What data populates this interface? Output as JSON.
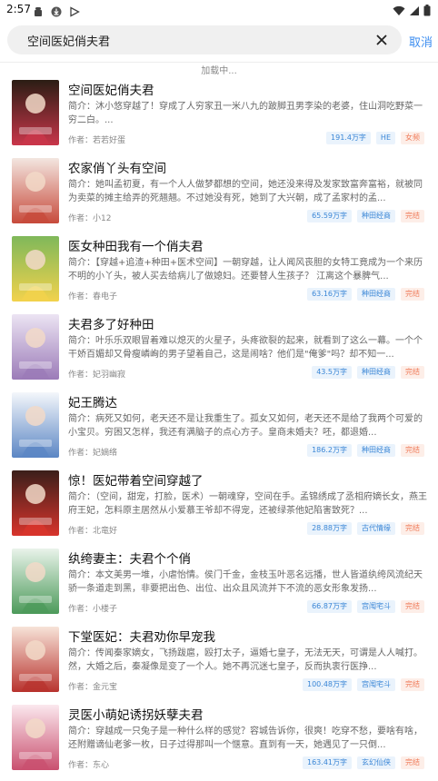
{
  "status_bar": {
    "time": "2:57",
    "left_icons": [
      "android-icon",
      "download-icon",
      "play-icon"
    ],
    "right_icons": [
      "wifi-icon",
      "signal-icon",
      "battery-icon"
    ]
  },
  "search": {
    "query": "空间医妃俏夫君",
    "cancel_label": "取消"
  },
  "loading_text": "加载中...",
  "colors": {
    "accent": "#3d8ef0",
    "tag_blue": "#3a86d6",
    "tag_orange": "#f07c5a"
  },
  "books": [
    {
      "title": "空间医妃俏夫君",
      "desc": "简介：沐小悠穿越了！穿成了人穷家丑一米八九的跛脚丑男李染的老婆，住山洞吃野菜一穷二白。...",
      "author": "作者：若若好蛋",
      "words": "191.4万字",
      "genre": "HE",
      "status": "女频",
      "cover_colors": [
        "#2b1d14",
        "#c9364a"
      ]
    },
    {
      "title": "农家俏丫头有空间",
      "desc": "简介：她叫孟初夏，有一个人人做梦都想的空间，她还没来得及发家致富奔富裕，就被同为卖菜的摊主给弄的死翘翘。不过她没有死，她到了大兴朝，成了孟家村的孟...",
      "author": "作者：小12",
      "words": "65.59万字",
      "genre": "种田经商",
      "status": "完结",
      "cover_colors": [
        "#f3e6e0",
        "#c74a3b"
      ]
    },
    {
      "title": "医女种田我有一个俏夫君",
      "desc": "简介：【穿越+追渣+种田+医术空间】一朝穿越，让人闻风丧胆的女特工竟成为一个来历不明的小丫头，被人买去给病儿了做媳妇。还要替人生孩子？ 江离这个暴脾气...",
      "author": "作者：春电子",
      "words": "63.16万字",
      "genre": "种田经商",
      "status": "完结",
      "cover_colors": [
        "#7fb85a",
        "#f2d24c"
      ]
    },
    {
      "title": "夫君多了好种田",
      "desc": "简介：叶乐乐双眼冒着难以熄灭的火星子，头疼欲裂的起来，就看到了这么一幕。一个个干娇百媚却又骨瘦嶙峋的男子望着自己，这是闹啥？他们是\"俺爹\"吗？却不知一...",
      "author": "作者：妃羽幽寂",
      "words": "43.5万字",
      "genre": "种田经商",
      "status": "完结",
      "cover_colors": [
        "#ece4f3",
        "#9b7bb8"
      ]
    },
    {
      "title": "妃王腾达",
      "desc": "简介：病死又如何，老天还不是让我重生了。孤女又如何，老天还不是给了我两个可爱的小宝贝。穷困又怎样，我还有满脑子的点心方子。皇商未婚夫？呸，都退婚...",
      "author": "作者：妃嫡络",
      "words": "186.2万字",
      "genre": "种田经商",
      "status": "完结",
      "cover_colors": [
        "#f4f7fb",
        "#5b86c4"
      ]
    },
    {
      "title": "惊！医妃带着空间穿越了",
      "desc": "简介：（空间，甜宠，打脸，医术）一朝魂穿，空间在手。孟锦绣成了丞相府嫡长女，燕王府王妃，怎料原主居然从小爱慕王爷却不得宠，还被绿茶他妃陷害致死？...",
      "author": "作者：北竜好",
      "words": "28.88万字",
      "genre": "古代情缘",
      "status": "完结",
      "cover_colors": [
        "#3b1f1a",
        "#d8342c"
      ]
    },
    {
      "title": "纨绔妻主：夫君个个俏",
      "desc": "简介：本文美男一堆，小虐怡情。侯门千金，金枝玉叶恶名远播，世人皆道纨绔风流纪天骄一条道走到黑，非要把出色、出位、出众且风流并下不流的恶女形象发扬...",
      "author": "作者：小楼子",
      "words": "66.87万字",
      "genre": "宫闱宅斗",
      "status": "完结",
      "cover_colors": [
        "#e9f3ea",
        "#4c9a5a"
      ]
    },
    {
      "title": "下堂医妃：夫君劝你早宠我",
      "desc": "简介：传闻秦家嫡女，飞扬跋扈，殴打太子，逼婚七皇子，无法无天，可谓是人人喊打。然，大婚之后，秦凝像是变了一个人。她不再沉迷七皇子，反而执衷行医挣...",
      "author": "作者：金元宝",
      "words": "100.48万字",
      "genre": "宫闱宅斗",
      "status": "完结",
      "cover_colors": [
        "#f7e3d8",
        "#b8332e"
      ]
    },
    {
      "title": "灵医小萌妃诱拐妖孽夫君",
      "desc": "简介：穿越成一只兔子是一种什么样的感觉？容城告诉你，很爽！吃穿不愁，要啥有啥，还附赠谪仙老爹一枚，日子过得那叫一个惬意。直到有一天，她遇见了一只倒...",
      "author": "作者：东心",
      "words": "163.41万字",
      "genre": "玄幻仙侠",
      "status": "完结",
      "cover_colors": [
        "#fbe8ee",
        "#c9506f"
      ]
    }
  ]
}
